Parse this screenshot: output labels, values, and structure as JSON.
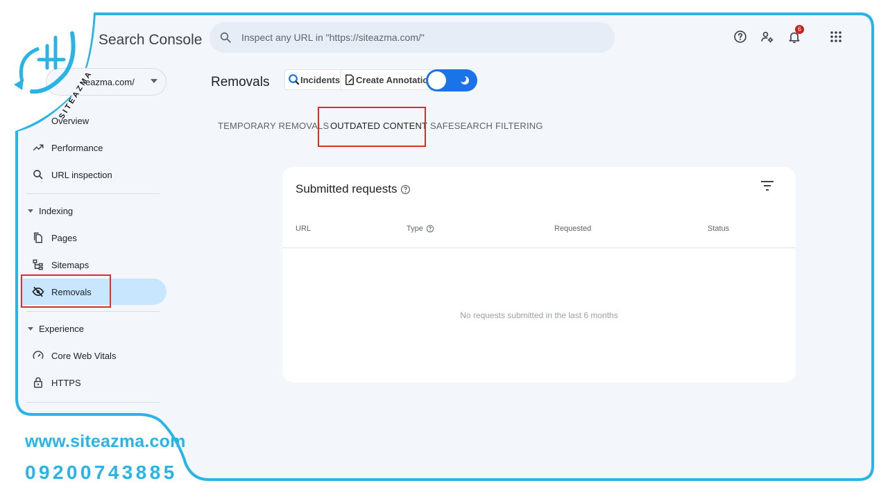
{
  "header": {
    "app_title": "Search Console",
    "search_placeholder": "Inspect any URL in \"https://siteazma.com/\"",
    "notification_count": "6"
  },
  "property_selector": {
    "value": "eazma.com/"
  },
  "sidebar": {
    "items_top": [
      {
        "label": "Overview",
        "icon": "home-icon"
      },
      {
        "label": "Performance",
        "icon": "trending-up-icon"
      },
      {
        "label": "URL inspection",
        "icon": "search-icon"
      }
    ],
    "indexing": {
      "label": "Indexing",
      "items": [
        {
          "label": "Pages",
          "icon": "pages-icon"
        },
        {
          "label": "Sitemaps",
          "icon": "sitemap-icon"
        },
        {
          "label": "Removals",
          "icon": "eye-off-icon",
          "selected": true
        }
      ]
    },
    "experience": {
      "label": "Experience",
      "items": [
        {
          "label": "Core Web Vitals",
          "icon": "gauge-icon"
        },
        {
          "label": "HTTPS",
          "icon": "lock-icon"
        }
      ]
    }
  },
  "page": {
    "title": "Removals",
    "incidents_label": "Incidents",
    "annotation_label": "Create Annotation",
    "dark_mode_toggle": "on"
  },
  "tabs": [
    {
      "label": "TEMPORARY REMOVALS",
      "active": false
    },
    {
      "label": "OUTDATED CONTENT",
      "active": true
    },
    {
      "label": "SAFESEARCH FILTERING",
      "active": false
    }
  ],
  "card": {
    "title": "Submitted requests",
    "columns": [
      "URL",
      "Type",
      "Requested",
      "Status"
    ],
    "empty_message": "No requests submitted in the last 6 months"
  },
  "branding": {
    "logo_text": "SITEAZMA",
    "website": "www.siteazma.com",
    "phone": "09200743885"
  },
  "colors": {
    "accent": "#29b4e8",
    "highlight": "#d93025",
    "selected_nav": "#c8e6fd",
    "toggle": "#1a73e8"
  }
}
